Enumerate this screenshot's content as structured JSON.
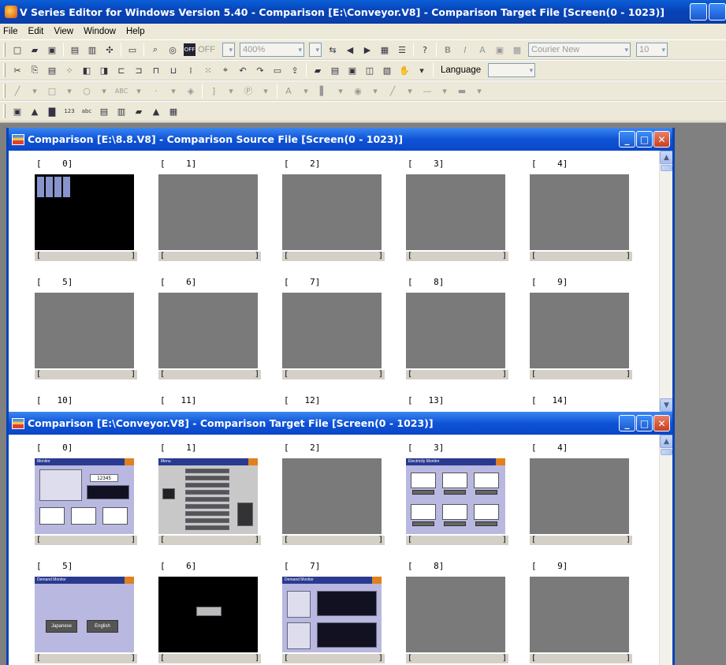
{
  "window": {
    "title": "V Series Editor for Windows Version 5.40 - Comparison [E:\\Conveyor.V8] - Comparison Target File [Screen(0 - 1023)]"
  },
  "menu": [
    "File",
    "Edit",
    "View",
    "Window",
    "Help"
  ],
  "toolbar": {
    "off_label": "OFF",
    "zoom_value": "400%",
    "font_value": "Courier New",
    "font_size": "10",
    "language_label": "Language"
  },
  "source_window": {
    "title": "Comparison [E:\\8.8.V8] - Comparison Source File [Screen(0 - 1023)]",
    "screens": [
      {
        "num": "[    0]",
        "style": "black-grid"
      },
      {
        "num": "[    1]",
        "style": "gray"
      },
      {
        "num": "[    2]",
        "style": "gray"
      },
      {
        "num": "[    3]",
        "style": "gray"
      },
      {
        "num": "[    4]",
        "style": "gray"
      },
      {
        "num": "[    5]",
        "style": "gray"
      },
      {
        "num": "[    6]",
        "style": "gray"
      },
      {
        "num": "[    7]",
        "style": "gray"
      },
      {
        "num": "[    8]",
        "style": "gray"
      },
      {
        "num": "[    9]",
        "style": "gray"
      },
      {
        "num": "[   10]",
        "style": "none"
      },
      {
        "num": "[   11]",
        "style": "none"
      },
      {
        "num": "[   12]",
        "style": "none"
      },
      {
        "num": "[   13]",
        "style": "none"
      },
      {
        "num": "[   14]",
        "style": "none"
      }
    ]
  },
  "target_window": {
    "title": "Comparison [E:\\Conveyor.V8] - Comparison Target File [Screen(0 - 1023)]",
    "screens": [
      {
        "num": "[    0]",
        "style": "monitor",
        "title": "Monitor",
        "value": "12345"
      },
      {
        "num": "[    1]",
        "style": "menu",
        "title": "Menu"
      },
      {
        "num": "[    2]",
        "style": "gray"
      },
      {
        "num": "[    3]",
        "style": "electricity",
        "title": "Electricity Monitor"
      },
      {
        "num": "[    4]",
        "style": "gray"
      },
      {
        "num": "[    5]",
        "style": "demand-lang",
        "title": "Demand Monitor",
        "btn1": "Japanese",
        "btn2": "English"
      },
      {
        "num": "[    6]",
        "style": "black-msg"
      },
      {
        "num": "[    7]",
        "style": "demand-graph",
        "title": "Demand Monitor"
      },
      {
        "num": "[    8]",
        "style": "gray"
      },
      {
        "num": "[    9]",
        "style": "gray"
      }
    ]
  },
  "caption_brackets": {
    "left": "[",
    "right": "]"
  }
}
